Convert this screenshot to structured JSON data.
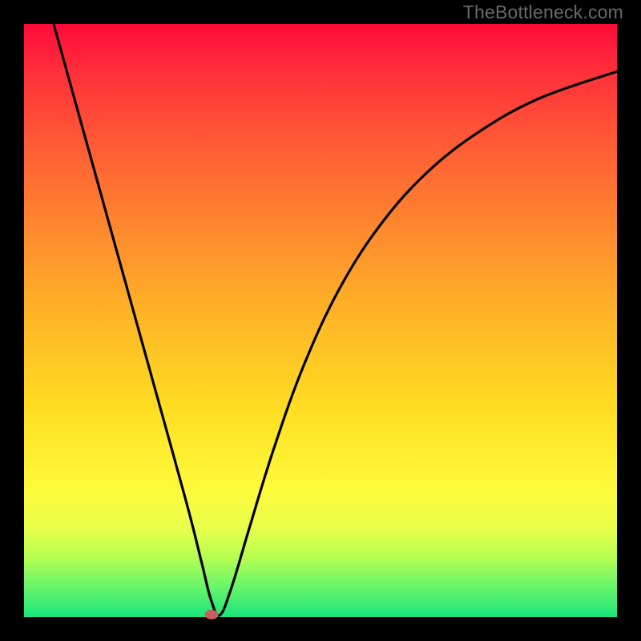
{
  "watermark": "TheBottleneck.com",
  "chart_data": {
    "type": "line",
    "title": "",
    "xlabel": "",
    "ylabel": "",
    "xlim": [
      0,
      100
    ],
    "ylim": [
      0,
      100
    ],
    "series": [
      {
        "name": "curve",
        "x": [
          5,
          10,
          15,
          20,
          25,
          28,
          30,
          31.5,
          33,
          35,
          38,
          42,
          47,
          53,
          60,
          68,
          77,
          87,
          100
        ],
        "y": [
          100,
          82,
          64,
          46,
          28,
          17,
          9,
          3,
          0.3,
          5,
          15,
          28,
          42,
          55,
          66,
          75,
          82,
          87.5,
          92
        ]
      }
    ],
    "marker": {
      "x": 31.6,
      "y": 0.4
    },
    "colors": {
      "frame": "#000000",
      "curve": "#000000",
      "marker": "#c95c5c",
      "gradient_top": "#ff0a3a",
      "gradient_bottom": "#1be57c"
    }
  }
}
